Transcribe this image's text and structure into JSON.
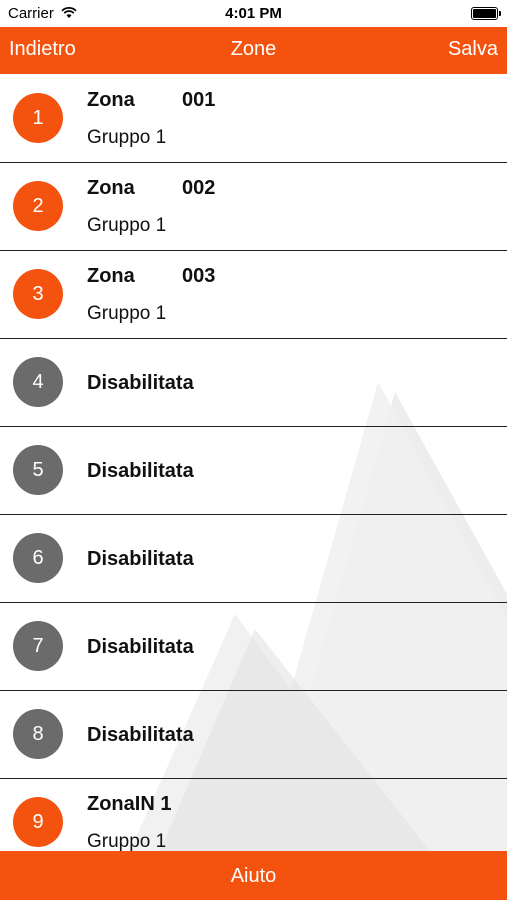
{
  "status": {
    "carrier": "Carrier",
    "time": "4:01 PM"
  },
  "nav": {
    "back_label": "Indietro",
    "title": "Zone",
    "save_label": "Salva"
  },
  "zones": [
    {
      "number": "1",
      "name": "Zona",
      "code": "001",
      "group": "Gruppo 1"
    },
    {
      "number": "2",
      "name": "Zona",
      "code": "002",
      "group": "Gruppo 1"
    },
    {
      "number": "3",
      "name": "Zona",
      "code": "003",
      "group": "Gruppo 1"
    },
    {
      "number": "4",
      "label": "Disabilitata"
    },
    {
      "number": "5",
      "label": "Disabilitata"
    },
    {
      "number": "6",
      "label": "Disabilitata"
    },
    {
      "number": "7",
      "label": "Disabilitata"
    },
    {
      "number": "8",
      "label": "Disabilitata"
    },
    {
      "number": "9",
      "name": "ZonaIN 1",
      "code": "",
      "group": "Gruppo 1"
    }
  ],
  "footer": {
    "help_label": "Aiuto"
  },
  "colors": {
    "accent": "#f4530f",
    "disabled": "#6b6b6b"
  }
}
